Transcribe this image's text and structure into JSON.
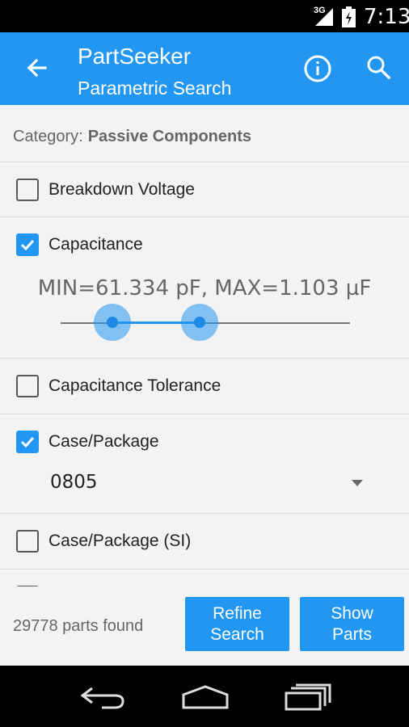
{
  "status_bar": {
    "network_type": "3G",
    "time": "7:13"
  },
  "app_bar": {
    "title": "PartSeeker",
    "subtitle": "Parametric Search",
    "icons": [
      "back-arrow-icon",
      "info-icon",
      "search-icon"
    ]
  },
  "category": {
    "label": "Category:",
    "value": "Passive Components"
  },
  "filters": [
    {
      "label": "Breakdown Voltage",
      "checked": false
    },
    {
      "label": "Capacitance",
      "checked": true,
      "range_text": "MIN=61.334 pF, MAX=1.103 µF",
      "slider_min_fraction": 0.18,
      "slider_max_fraction": 0.48
    },
    {
      "label": "Capacitance Tolerance",
      "checked": false
    },
    {
      "label": "Case/Package",
      "checked": true,
      "dropdown_value": "0805"
    },
    {
      "label": "Case/Package (SI)",
      "checked": false
    },
    {
      "label": "",
      "checked": false
    }
  ],
  "footer": {
    "parts_found": "29778 parts found",
    "refine_line1": "Refine",
    "refine_line2": "Search",
    "show_line1": "Show",
    "show_line2": "Parts"
  },
  "colors": {
    "accent": "#2196f3",
    "background": "#f3f3f3"
  },
  "nav_bar": {
    "icons": [
      "back-nav-icon",
      "home-nav-icon",
      "recents-nav-icon"
    ]
  }
}
